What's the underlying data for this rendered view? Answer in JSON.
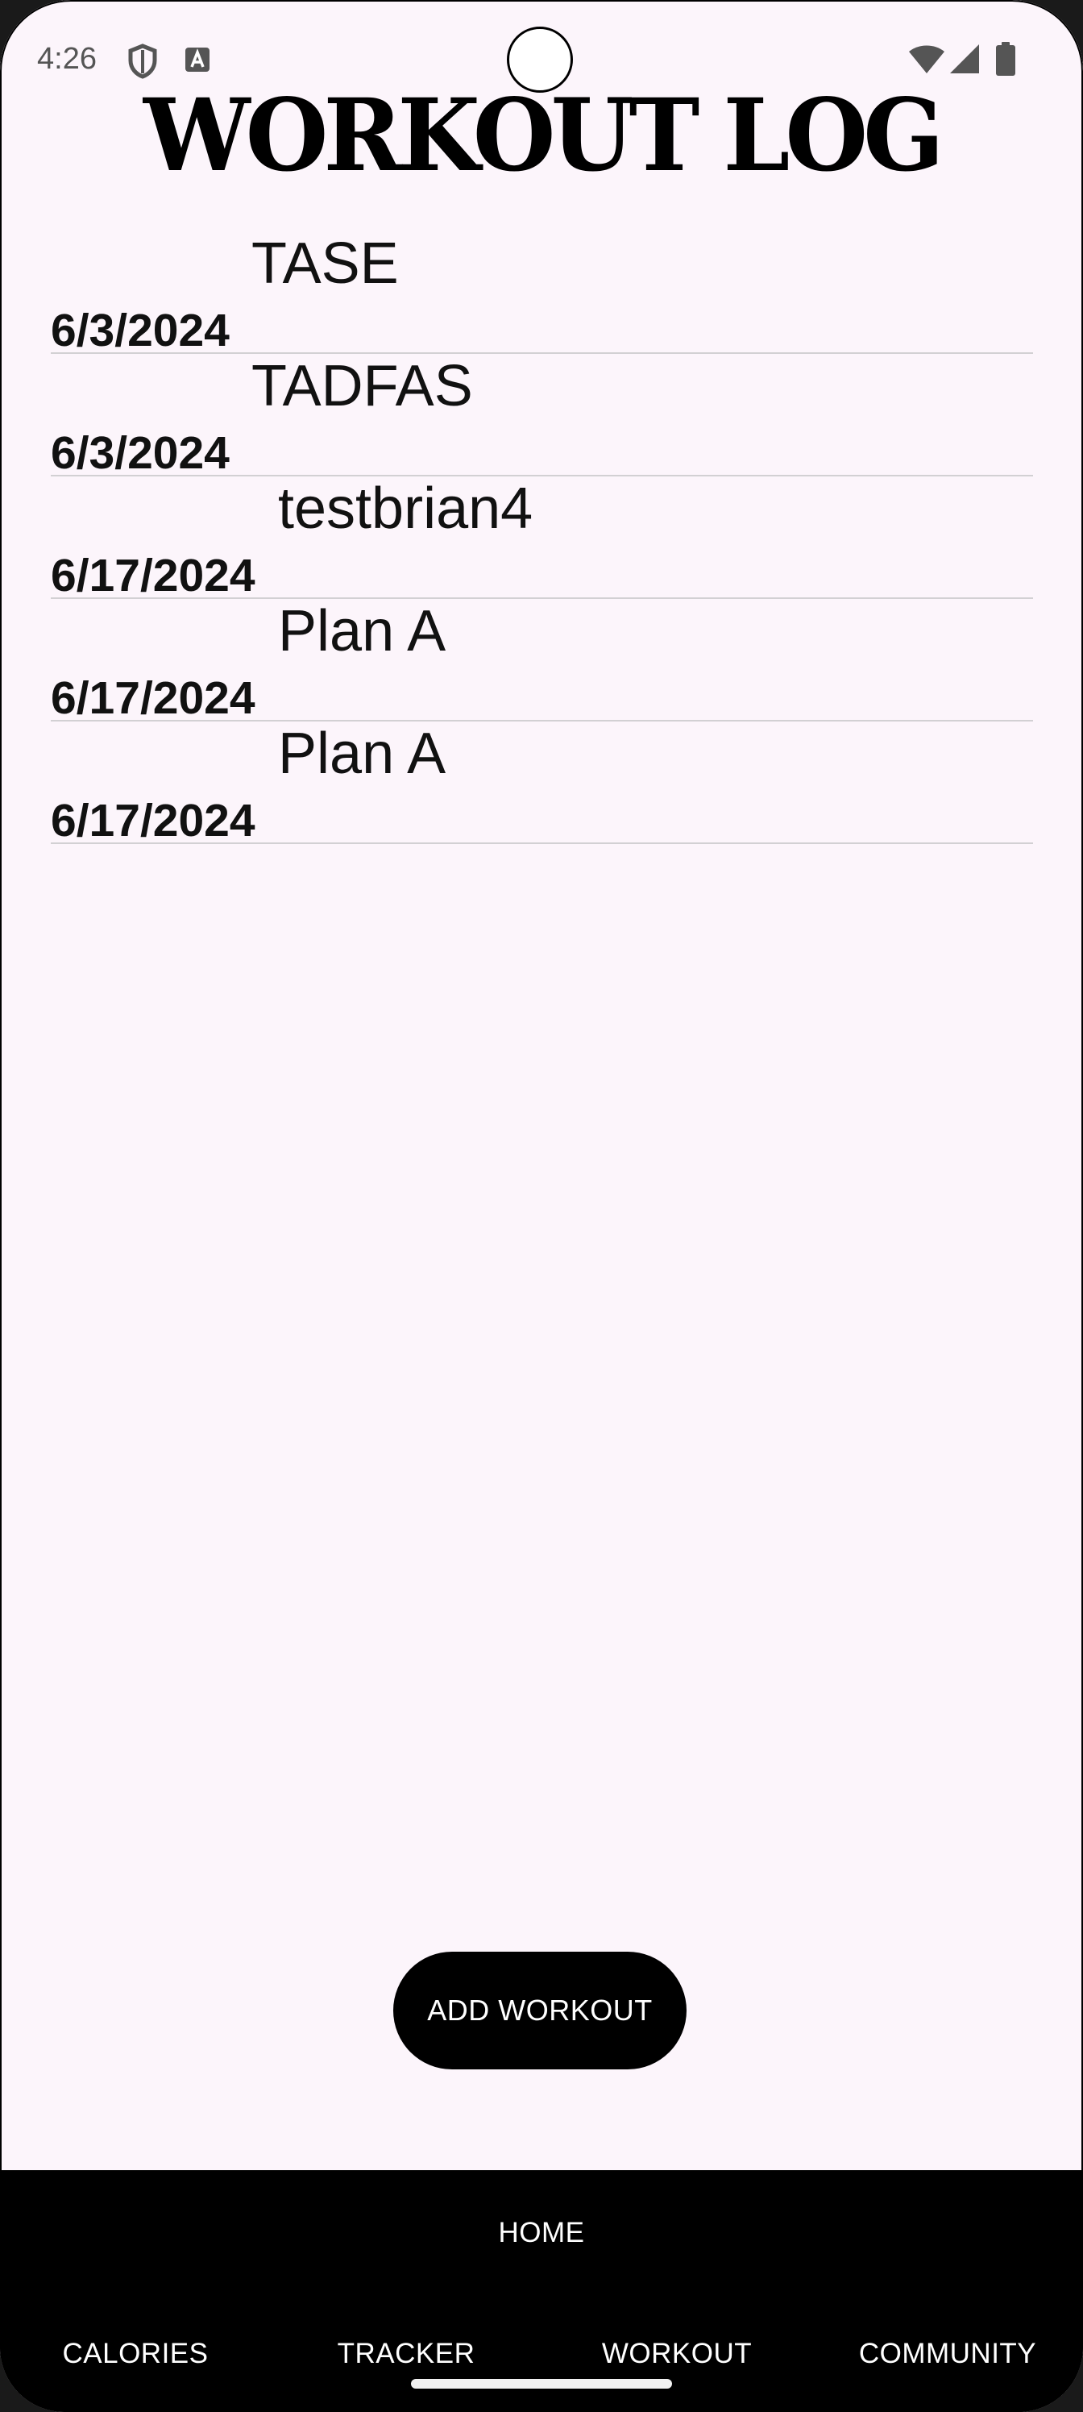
{
  "status_bar": {
    "time": "4:26",
    "icons": [
      "shield-icon",
      "a-box-icon",
      "wifi-icon",
      "signal-icon",
      "battery-icon"
    ]
  },
  "page": {
    "title": "WORKOUT LOG"
  },
  "logs": [
    {
      "name": "TASE",
      "date": "6/3/2024"
    },
    {
      "name": "TADFAS",
      "date": "6/3/2024"
    },
    {
      "name": "testbrian4",
      "date": "6/17/2024"
    },
    {
      "name": "Plan A",
      "date": "6/17/2024"
    },
    {
      "name": "Plan A",
      "date": "6/17/2024"
    }
  ],
  "actions": {
    "add_workout_label": "ADD WORKOUT"
  },
  "nav": {
    "home": "HOME",
    "calories": "CALORIES",
    "tracker": "TRACKER",
    "workout": "WORKOUT",
    "community": "COMMUNITY"
  },
  "colors": {
    "background": "#fcf5fb",
    "nav_background": "#000000",
    "button_background": "#000000",
    "divider": "#d2d0d3"
  }
}
